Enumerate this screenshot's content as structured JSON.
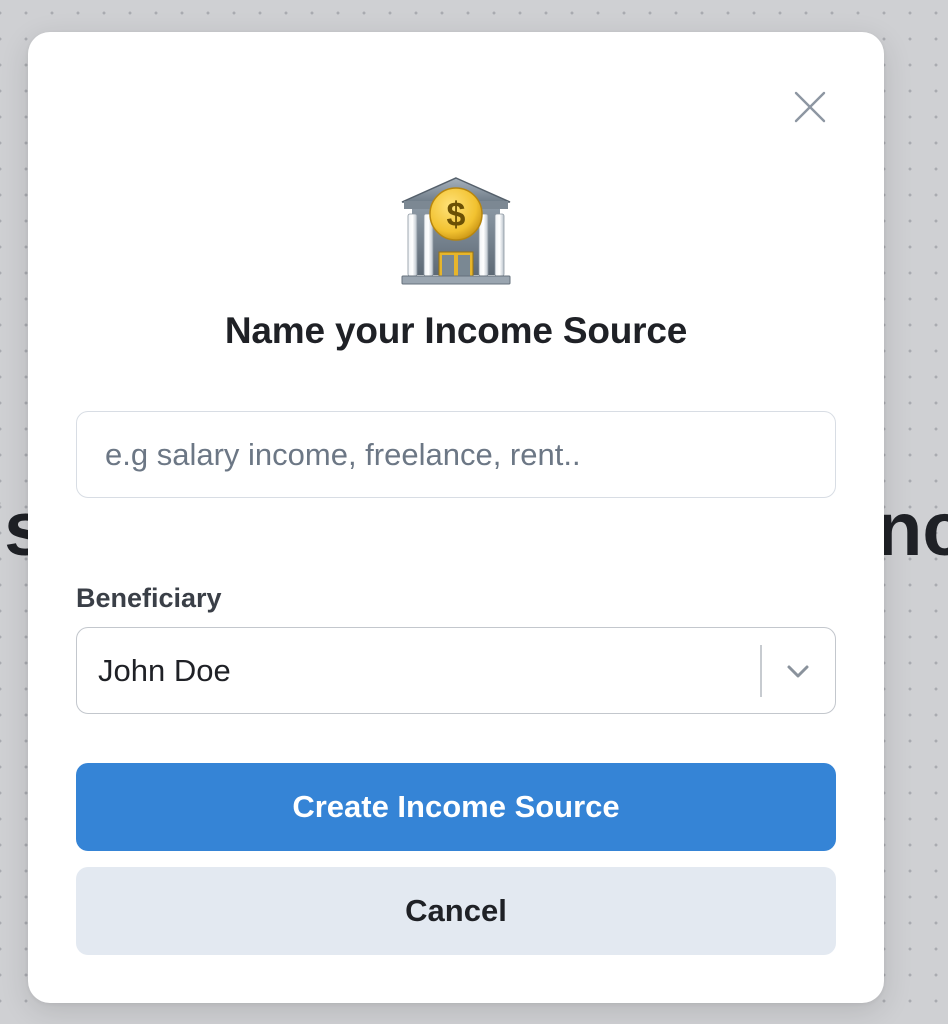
{
  "backdrop": {
    "left_fragment": "'s",
    "right_fragment": "nc"
  },
  "modal": {
    "close_icon": "close-icon",
    "header_icon": "bank-icon",
    "title": "Name your Income Source",
    "name_input": {
      "placeholder": "e.g salary income, freelance, rent..",
      "value": ""
    },
    "beneficiary": {
      "label": "Beneficiary",
      "selected": "John Doe",
      "chevron_icon": "chevron-down-icon"
    },
    "create_button": "Create Income Source",
    "cancel_button": "Cancel"
  },
  "colors": {
    "primary": "#3584d6",
    "secondary": "#e3e9f1",
    "text": "#1f2126",
    "coin": "#f2c230"
  }
}
